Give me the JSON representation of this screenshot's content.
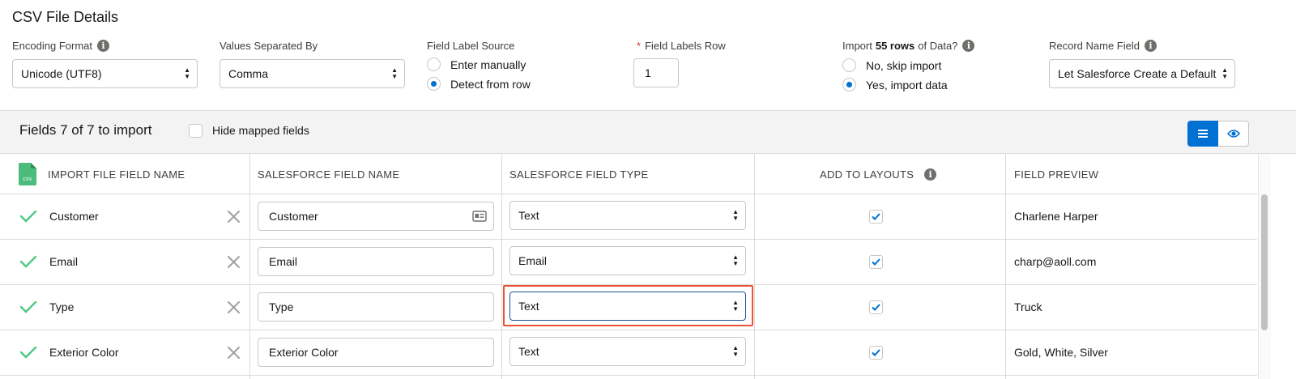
{
  "section_title": "CSV File Details",
  "config": {
    "encoding": {
      "label": "Encoding Format",
      "value": "Unicode (UTF8)"
    },
    "separator": {
      "label": "Values Separated By",
      "value": "Comma"
    },
    "label_source": {
      "label": "Field Label Source",
      "options": [
        "Enter manually",
        "Detect from row"
      ],
      "selected": "Detect from row"
    },
    "labels_row": {
      "required_mark": "*",
      "label": "Field Labels Row",
      "value": "1"
    },
    "import_rows": {
      "label_prefix": "Import",
      "label_bold": "55 rows",
      "label_suffix": "of Data?",
      "options": [
        "No, skip import",
        "Yes, import data"
      ],
      "selected": "Yes, import data"
    },
    "record_name": {
      "label": "Record Name Field",
      "value": "Let Salesforce Create a Default"
    }
  },
  "fields_bar": {
    "title": "Fields 7 of 7 to import",
    "hide_mapped_label": "Hide mapped fields",
    "hide_mapped_checked": false
  },
  "table": {
    "file_icon_text": "csv",
    "headers": [
      "IMPORT FILE FIELD NAME",
      "SALESFORCE FIELD NAME",
      "SALESFORCE FIELD TYPE",
      "ADD TO LAYOUTS",
      "FIELD PREVIEW"
    ],
    "rows": [
      {
        "import_name": "Customer",
        "sf_name": "Customer",
        "sf_type": "Text",
        "add_to_layouts": true,
        "preview": "Charlene Harper"
      },
      {
        "import_name": "Email",
        "sf_name": "Email",
        "sf_type": "Email",
        "add_to_layouts": true,
        "preview": "charp@aoll.com"
      },
      {
        "import_name": "Type",
        "sf_name": "Type",
        "sf_type": "Text",
        "add_to_layouts": true,
        "preview": "Truck"
      },
      {
        "import_name": "Exterior Color",
        "sf_name": "Exterior Color",
        "sf_type": "Text",
        "add_to_layouts": true,
        "preview": "Gold, White, Silver"
      }
    ]
  },
  "colors": {
    "brand_blue": "#0070d2",
    "success_green": "#4bca81",
    "highlight": "#e8533a",
    "border": "#dddbda"
  }
}
